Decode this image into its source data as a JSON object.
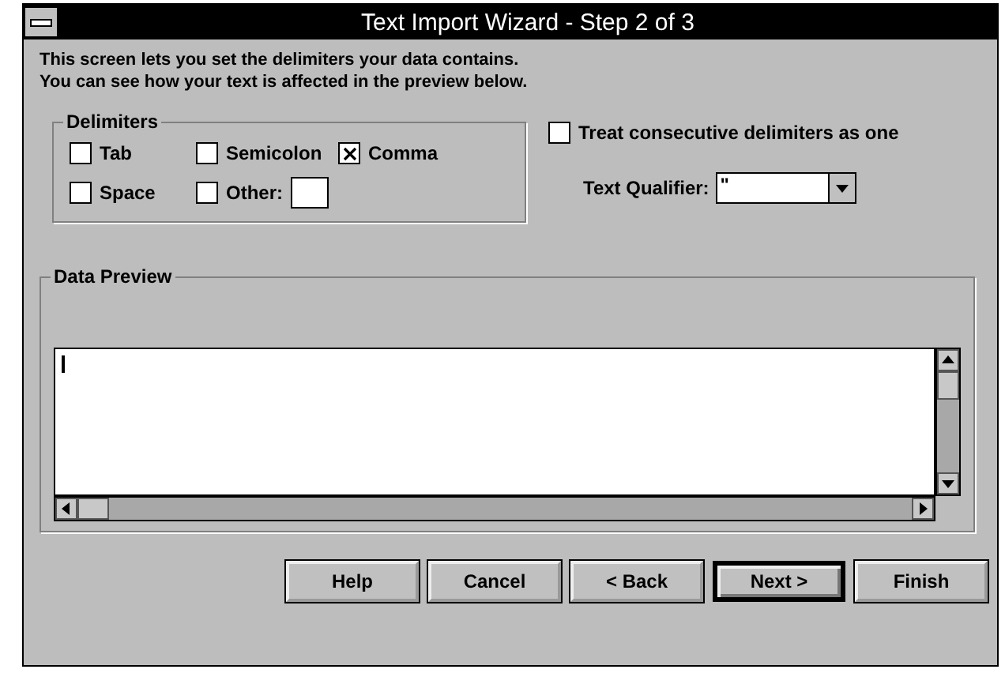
{
  "window": {
    "title": "Text Import Wizard - Step 2 of 3"
  },
  "intro": [
    "This screen lets you set the delimiters your data contains.",
    "You can see how your text is affected in the preview below."
  ],
  "delimiters": {
    "title": "Delimiters",
    "options": [
      {
        "label": "Tab",
        "checked": false
      },
      {
        "label": "Semicolon",
        "checked": false
      },
      {
        "label": "Comma",
        "checked": true
      },
      {
        "label": "Space",
        "checked": false
      },
      {
        "label": "Other:",
        "checked": false,
        "kind": "other"
      }
    ]
  },
  "treat_consecutive": {
    "label": "Treat consecutive delimiters as one",
    "checked": false
  },
  "text_qualifier": {
    "label": "Text Qualifier:",
    "value": "\""
  },
  "data_preview": {
    "title": "Data Preview"
  },
  "buttons": [
    {
      "label": "Help",
      "default": false
    },
    {
      "label": "Cancel",
      "default": false
    },
    {
      "label": "< Back",
      "default": false
    },
    {
      "label": "Next >",
      "default": true
    },
    {
      "label": "Finish",
      "default": false
    }
  ]
}
